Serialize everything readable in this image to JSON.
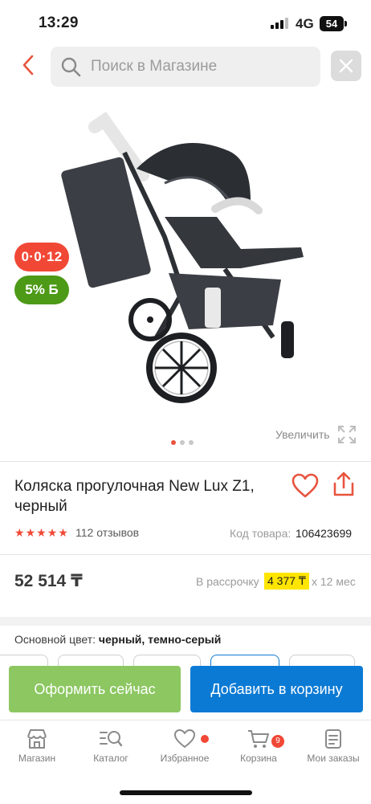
{
  "status_bar": {
    "time": "13:29",
    "network": "4G",
    "battery": "54"
  },
  "header": {
    "search_placeholder": "Поиск в Магазине"
  },
  "gallery": {
    "badge_installment": "0·0·12",
    "badge_bonus": "5% Б",
    "zoom_label": "Увеличить",
    "dots_total": 3,
    "dots_active": 1
  },
  "product": {
    "title": "Коляска прогулочная New Lux Z1, черный",
    "rating_stars": 5,
    "reviews": "112 отзывов",
    "code_label": "Код товара:",
    "code_value": "106423699",
    "price": "52 514 ₸",
    "installment_label": "В рассрочку",
    "installment_amount": "4 377 ₸",
    "installment_months": "x 12 мес",
    "color_label": "Основной цвет:",
    "color_value": "черный, темно-серый"
  },
  "actions": {
    "order_now": "Оформить сейчас",
    "add_to_cart": "Добавить в корзину"
  },
  "bottom_nav": {
    "items": [
      {
        "label": "Магазин",
        "icon": "store-icon"
      },
      {
        "label": "Каталог",
        "icon": "catalog-search-icon"
      },
      {
        "label": "Избранное",
        "icon": "heart-icon"
      },
      {
        "label": "Корзина",
        "icon": "cart-icon",
        "badge": "9"
      },
      {
        "label": "Мои заказы",
        "icon": "orders-icon"
      }
    ]
  },
  "colors": {
    "accent_red": "#f14836",
    "green": "#4d9a16",
    "order_button": "#8cc761",
    "cart_button": "#0b7ad4",
    "installment_highlight": "#ffe500"
  }
}
